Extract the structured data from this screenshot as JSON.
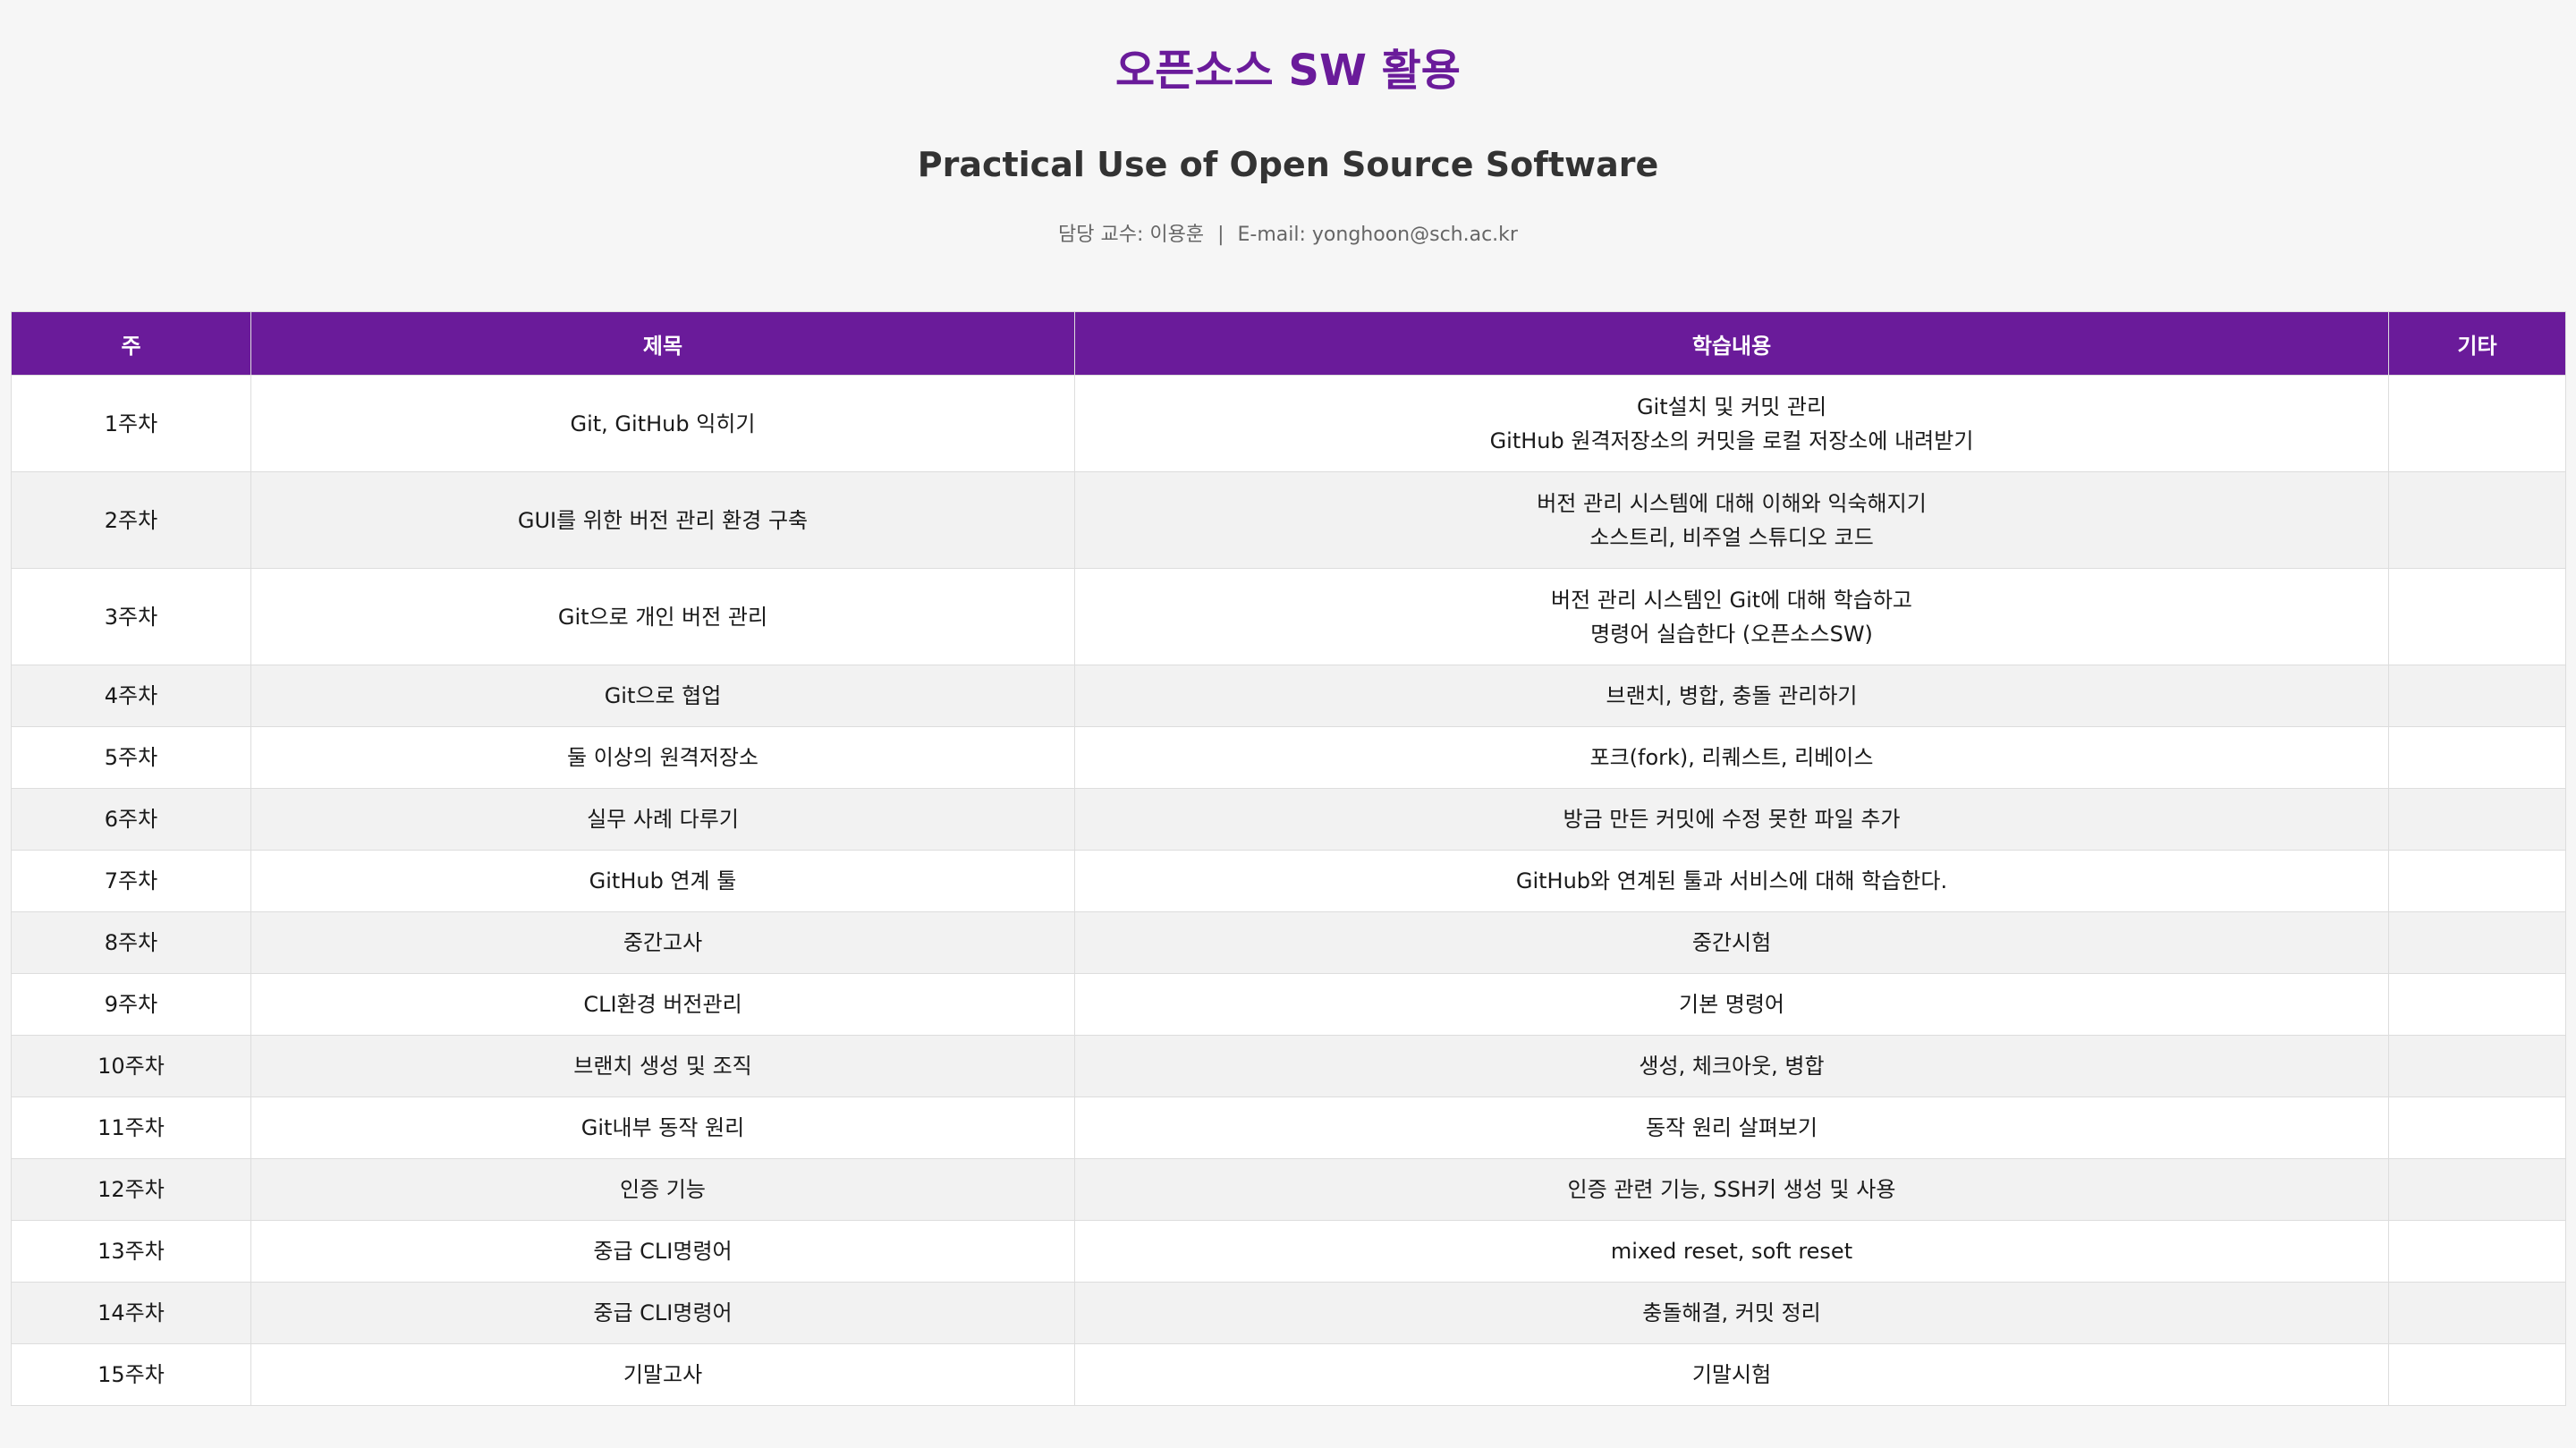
{
  "header": {
    "title": "오픈소스 SW 활용",
    "subtitle": "Practical Use of Open Source Software",
    "professor": "담당 교수: 이용훈",
    "separator": "|",
    "email": "E-mail: yonghoon@sch.ac.kr"
  },
  "table": {
    "columns": [
      "주",
      "제목",
      "학습내용",
      "기타"
    ],
    "rows": [
      {
        "week": "1주차",
        "title": "Git, GitHub 익히기",
        "content": [
          "Git설치 및 커밋 관리",
          "GitHub 원격저장소의 커밋을 로컬 저장소에 내려받기"
        ],
        "etc": ""
      },
      {
        "week": "2주차",
        "title": "GUI를 위한 버전 관리 환경 구축",
        "content": [
          "버전 관리 시스템에 대해 이해와 익숙해지기",
          "소스트리, 비주얼 스튜디오 코드"
        ],
        "etc": ""
      },
      {
        "week": "3주차",
        "title": "Git으로 개인 버전 관리",
        "content": [
          "버전 관리 시스템인 Git에 대해 학습하고",
          "명령어 실습한다 (오픈소스SW)"
        ],
        "etc": ""
      },
      {
        "week": "4주차",
        "title": "Git으로 협업",
        "content": [
          "브랜치, 병합, 충돌 관리하기"
        ],
        "etc": ""
      },
      {
        "week": "5주차",
        "title": "둘 이상의 원격저장소",
        "content": [
          "포크(fork), 리퀘스트, 리베이스"
        ],
        "etc": ""
      },
      {
        "week": "6주차",
        "title": "실무 사례 다루기",
        "content": [
          "방금 만든 커밋에 수정 못한 파일 추가"
        ],
        "etc": ""
      },
      {
        "week": "7주차",
        "title": "GitHub 연계 툴",
        "content": [
          "GitHub와 연계된 툴과 서비스에 대해 학습한다."
        ],
        "etc": ""
      },
      {
        "week": "8주차",
        "title": "중간고사",
        "content": [
          "중간시험"
        ],
        "etc": ""
      },
      {
        "week": "9주차",
        "title": "CLI환경 버전관리",
        "content": [
          "기본 명령어"
        ],
        "etc": ""
      },
      {
        "week": "10주차",
        "title": "브랜치 생성 및 조직",
        "content": [
          "생성, 체크아웃, 병합"
        ],
        "etc": ""
      },
      {
        "week": "11주차",
        "title": "Git내부 동작 원리",
        "content": [
          "동작 원리 살펴보기"
        ],
        "etc": ""
      },
      {
        "week": "12주차",
        "title": "인증 기능",
        "content": [
          "인증 관련 기능, SSH키 생성 및 사용"
        ],
        "etc": ""
      },
      {
        "week": "13주차",
        "title": "중급 CLI명령어",
        "content": [
          "mixed reset, soft reset"
        ],
        "etc": ""
      },
      {
        "week": "14주차",
        "title": "중급 CLI명령어",
        "content": [
          "충돌해결, 커밋 정리"
        ],
        "etc": ""
      },
      {
        "week": "15주차",
        "title": "기말고사",
        "content": [
          "기말시험"
        ],
        "etc": ""
      }
    ]
  },
  "colors": {
    "accent": "#6a1b9a",
    "header_text": "#ffffff",
    "row_even": "#f2f2f2",
    "row_odd": "#ffffff"
  }
}
